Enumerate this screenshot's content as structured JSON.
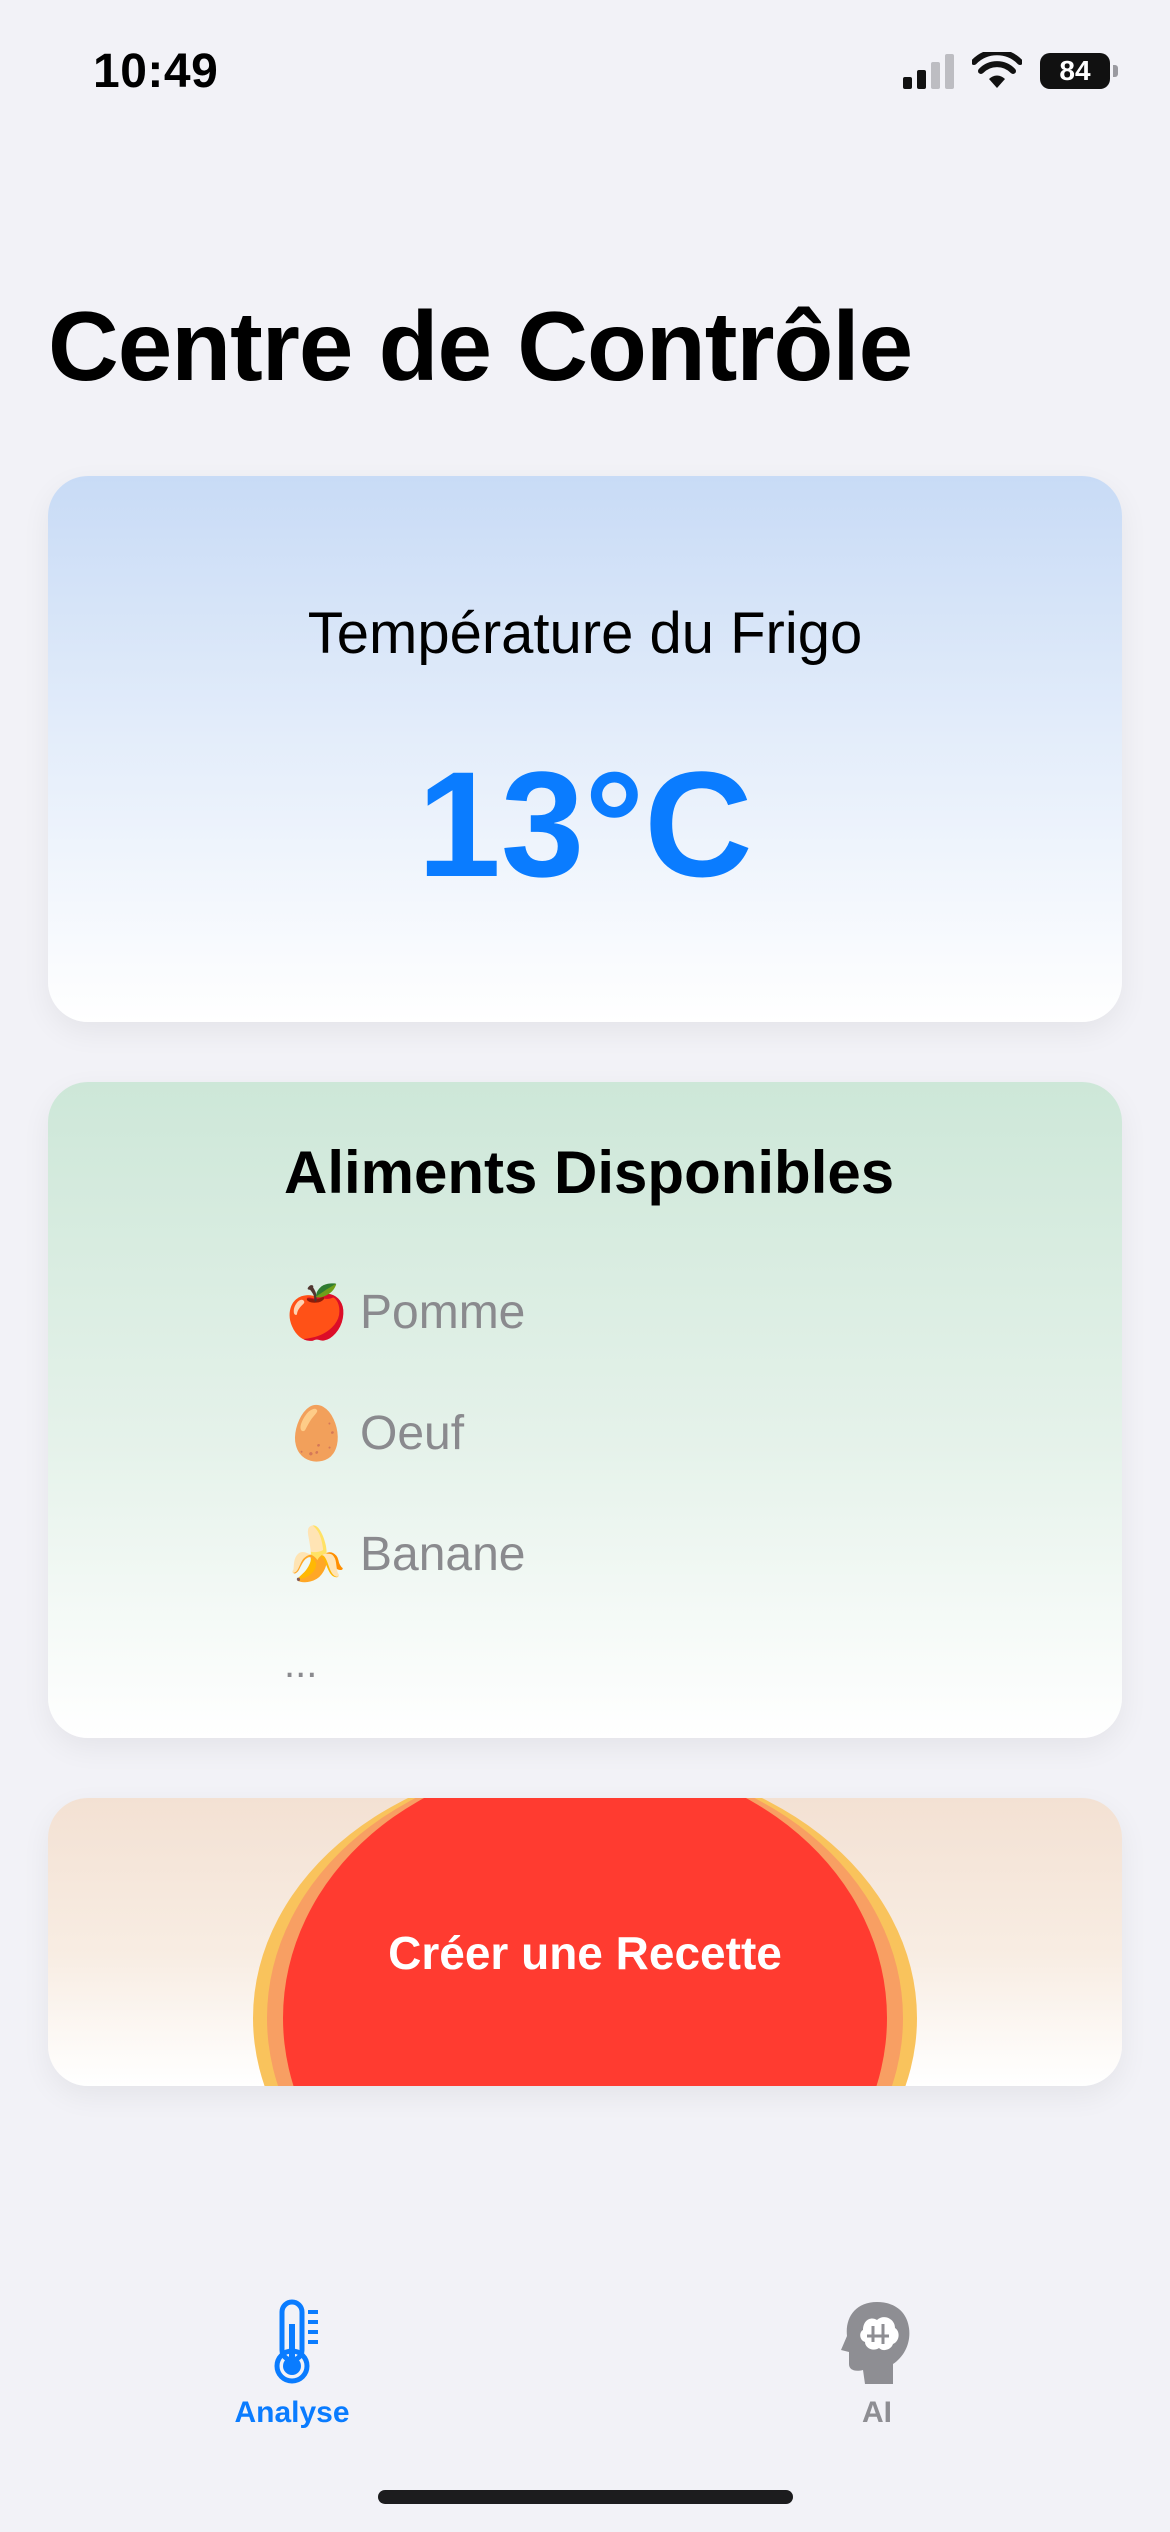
{
  "status_bar": {
    "time": "10:49",
    "battery": "84",
    "icons": [
      "cellular-signal-icon",
      "wifi-icon",
      "battery-icon"
    ]
  },
  "page": {
    "title": "Centre de Contrôle"
  },
  "temperature_card": {
    "label": "Température du Frigo",
    "value": "13°C",
    "accent_color": "#0a7cff"
  },
  "food_card": {
    "title": "Aliments Disponibles",
    "items": [
      {
        "emoji": "🍎",
        "name": "Pomme"
      },
      {
        "emoji": "🥚",
        "name": "Oeuf"
      },
      {
        "emoji": "🍌",
        "name": "Banane"
      }
    ],
    "more": "..."
  },
  "recipe_card": {
    "button_label": "Créer une Recette",
    "button_color": "#ff3b30"
  },
  "tab_bar": {
    "tabs": [
      {
        "label": "Analyse",
        "icon": "thermometer-icon",
        "selected": true
      },
      {
        "label": "AI",
        "icon": "brain-head-icon",
        "selected": false
      }
    ]
  }
}
